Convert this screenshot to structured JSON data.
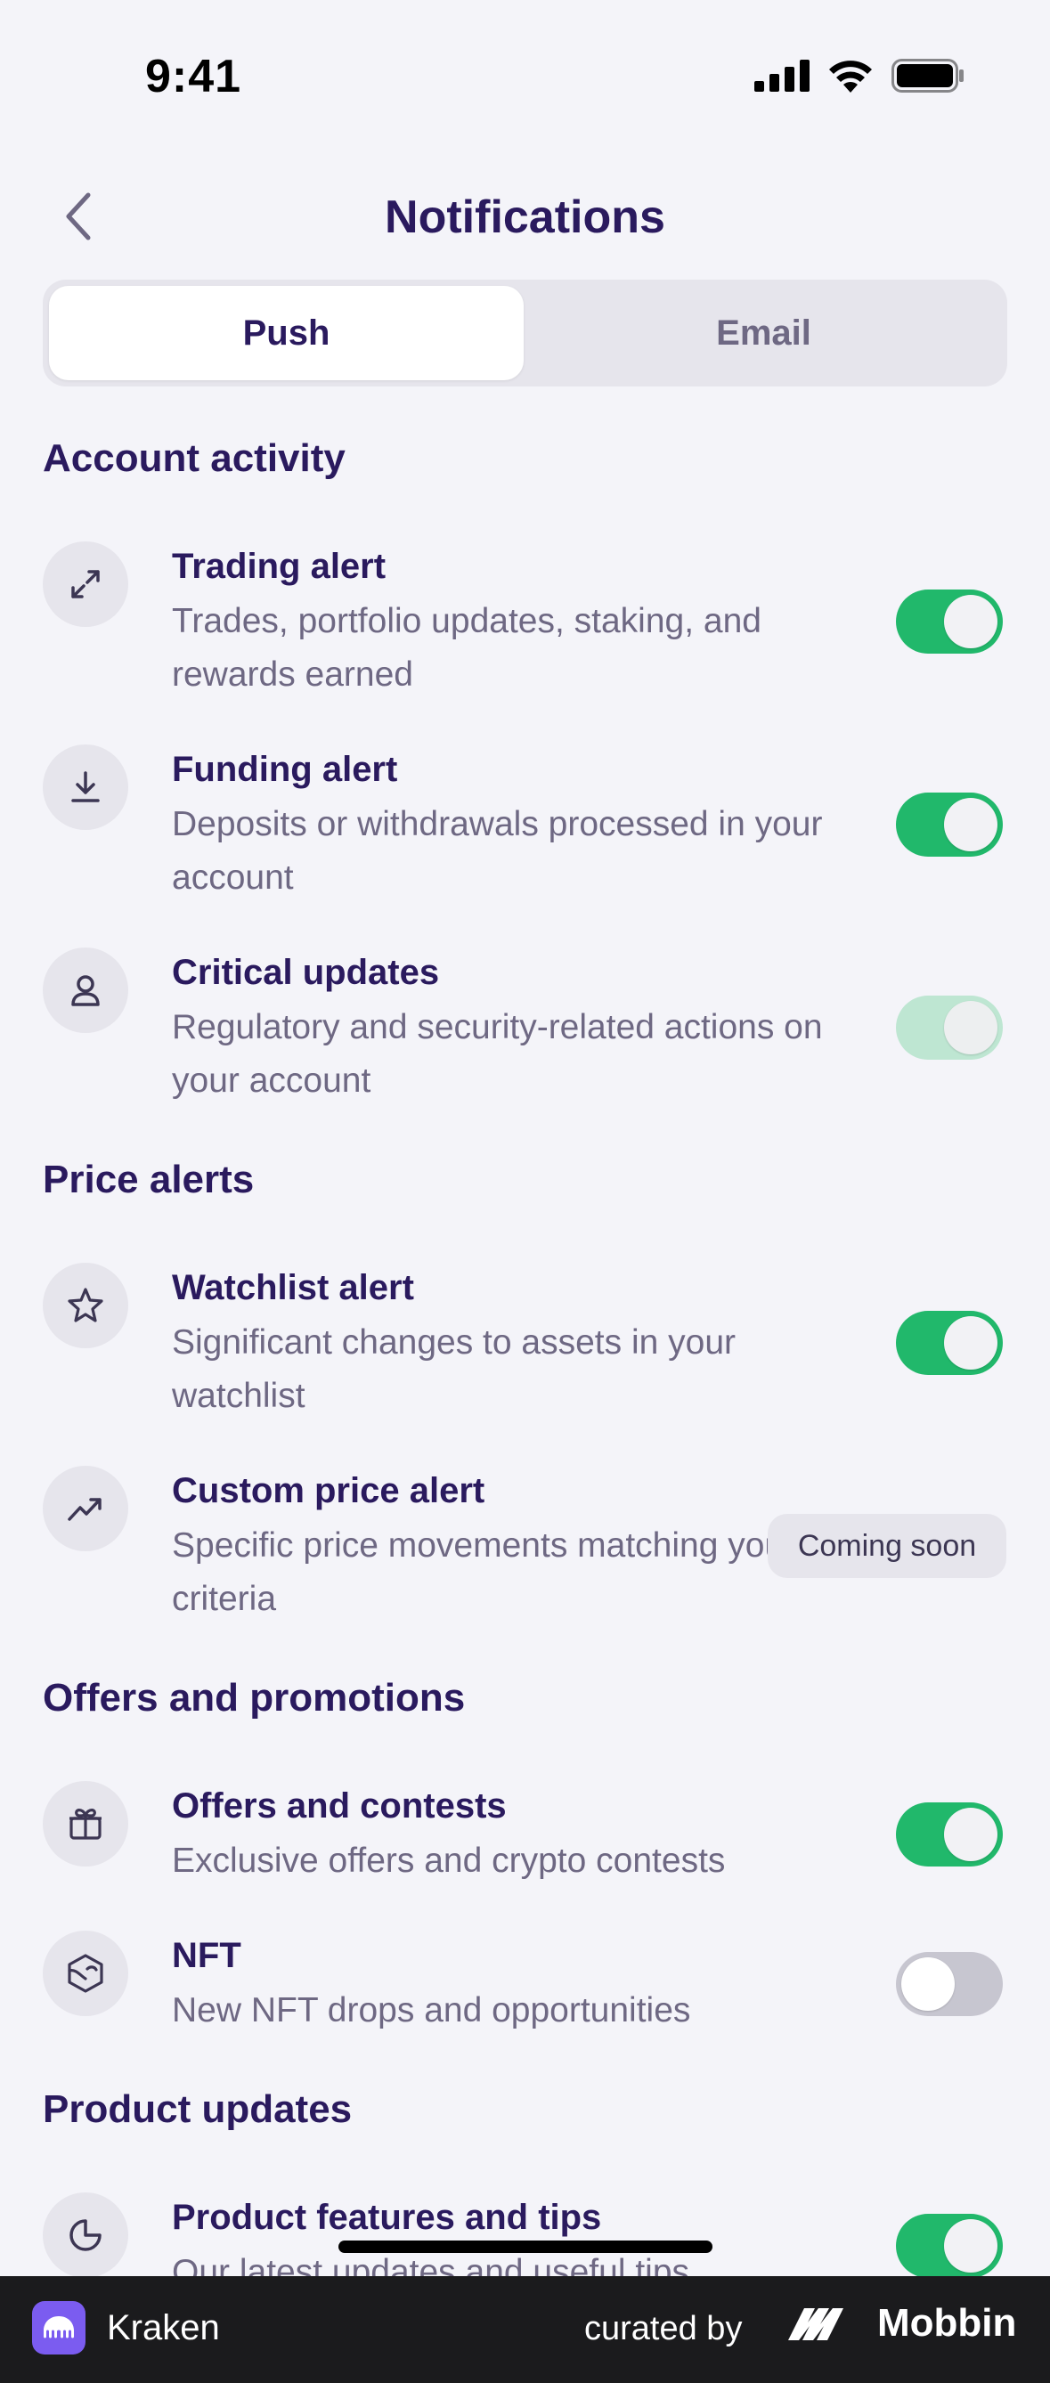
{
  "status_bar": {
    "time": "9:41"
  },
  "header": {
    "title": "Notifications"
  },
  "tabs": [
    {
      "label": "Push",
      "active": true
    },
    {
      "label": "Email",
      "active": false
    }
  ],
  "sections": {
    "account": {
      "title": "Account activity",
      "items": [
        {
          "title": "Trading alert",
          "desc": "Trades, portfolio updates, staking, and rewards earned",
          "icon": "swap-arrows-icon",
          "state": "on"
        },
        {
          "title": "Funding alert",
          "desc": "Deposits or withdrawals processed in your account",
          "icon": "download-icon",
          "state": "on"
        },
        {
          "title": "Critical updates",
          "desc": "Regulatory and security-related actions on your account",
          "icon": "user-icon",
          "state": "on-disabled"
        }
      ]
    },
    "price": {
      "title": "Price alerts",
      "items": [
        {
          "title": "Watchlist alert",
          "desc": "Significant changes to assets in your watchlist",
          "icon": "star-icon",
          "state": "on"
        },
        {
          "title": "Custom price alert",
          "desc": "Specific price movements matching your criteria",
          "icon": "trending-up-icon",
          "badge": "Coming soon"
        }
      ]
    },
    "offers": {
      "title": "Offers and promotions",
      "items": [
        {
          "title": "Offers and contests",
          "desc": "Exclusive offers and crypto contests",
          "icon": "gift-icon",
          "state": "on"
        },
        {
          "title": "NFT",
          "desc": "New NFT drops and opportunities",
          "icon": "nft-icon",
          "state": "off"
        }
      ]
    },
    "product": {
      "title": "Product updates",
      "items": [
        {
          "title": "Product features and tips",
          "desc": "Our latest updates and useful tips",
          "icon": "pie-chart-icon",
          "state": "on"
        }
      ]
    }
  },
  "footer": {
    "app_name": "Kraken",
    "curated_by": "curated by",
    "brand": "Mobbin"
  },
  "colors": {
    "toggle_on": "#21B86B",
    "toggle_disabled": "#BEE6D2",
    "toggle_off": "#C7C6D0",
    "title": "#2A1A5E",
    "subtext": "#6E6883"
  }
}
